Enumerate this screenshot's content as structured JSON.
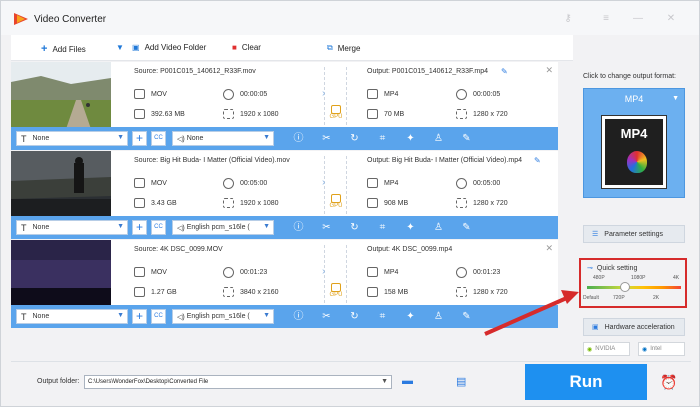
{
  "app": {
    "title": "Video Converter",
    "brand_colors": {
      "accent": "#1e90f0",
      "control_bar": "#5aa4ec",
      "highlight": "#d62b2b",
      "gpu": "#e0a11b"
    }
  },
  "toolbar": {
    "add_files": "Add Files",
    "add_video_folder": "Add Video Folder",
    "clear": "Clear",
    "merge": "Merge"
  },
  "items": [
    {
      "source": "Source: P001C015_140612_R33F.mov",
      "src_format": "MOV",
      "src_duration": "00:00:05",
      "src_size": "392.63 MB",
      "src_resolution": "1920 x 1080",
      "output": "Output: P001C015_140612_R33F.mp4",
      "dst_format": "MP4",
      "dst_duration": "00:00:05",
      "dst_size": "70 MB",
      "dst_resolution": "1280 x 720",
      "subtitle": "None",
      "audio": "None"
    },
    {
      "source": "Source: Big Hit Buda- I Matter (Official Video).mov",
      "src_format": "MOV",
      "src_duration": "00:05:00",
      "src_size": "3.43 GB",
      "src_resolution": "1920 x 1080",
      "output": "Output: Big Hit Buda- I Matter (Official Video).mp4",
      "dst_format": "MP4",
      "dst_duration": "00:05:00",
      "dst_size": "908 MB",
      "dst_resolution": "1280 x 720",
      "subtitle": "None",
      "audio": "English pcm_s16le ("
    },
    {
      "source": "Source: 4K DSC_0099.MOV",
      "src_format": "MOV",
      "src_duration": "00:01:23",
      "src_size": "1.27 GB",
      "src_resolution": "3840 x 2160",
      "output": "Output: 4K DSC_0099.mp4",
      "dst_format": "MP4",
      "dst_duration": "00:01:23",
      "dst_size": "158 MB",
      "dst_resolution": "1280 x 720",
      "subtitle": "None",
      "audio": "English pcm_s16le ("
    }
  ],
  "gpu_label": "GPU",
  "right": {
    "change_format_label": "Click to change output format:",
    "format": "MP4",
    "format_image_text": "MP4",
    "parameter_settings": "Parameter settings",
    "quick_setting": "Quick setting",
    "q_top": [
      "480P",
      "1080P",
      "4K"
    ],
    "q_bottom": [
      "Default",
      "720P",
      "2K"
    ],
    "quality_level": 0.4,
    "hardware_acceleration": "Hardware acceleration",
    "nvidia": "NVIDIA",
    "intel": "Intel"
  },
  "bottom": {
    "output_folder_label": "Output folder:",
    "output_folder_value": "C:\\Users\\WonderFox\\Desktop\\Converted File",
    "run": "Run"
  }
}
